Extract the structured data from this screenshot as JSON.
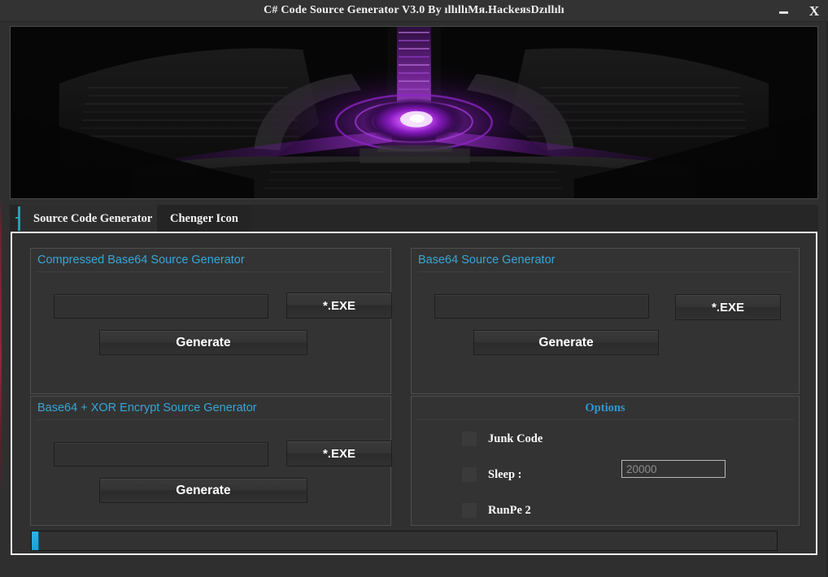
{
  "window": {
    "title": "C# Code Source Generator V3.0 By ıllıllıMя.HackeяsDzıllılı",
    "minimize_label": "—",
    "close_label": "X",
    "accent_color": "#2f9cb0",
    "group_title_color": "#37a6d6",
    "progress_color": "#2fb4e4"
  },
  "banner": {
    "alt": "dark sci-fi portal artwork with purple glowing core",
    "glow_color": "#b030e0"
  },
  "tabs": [
    {
      "label": "Source Code Generator",
      "active": true
    },
    {
      "label": "Chenger Icon",
      "active": false
    }
  ],
  "groups": {
    "compressed_base64": {
      "title": "Compressed Base64 Source  Generator",
      "path_value": "",
      "path_placeholder": "",
      "browse_label": "*.EXE",
      "generate_label": "Generate"
    },
    "base64": {
      "title": "Base64  Source  Generator",
      "path_value": "",
      "path_placeholder": "",
      "browse_label": "*.EXE",
      "generate_label": "Generate"
    },
    "base64_xor": {
      "title": "Base64 + XOR Encrypt Source  Generator",
      "path_value": "",
      "path_placeholder": "",
      "browse_label": "*.EXE",
      "generate_label": "Generate"
    },
    "options": {
      "title": "Options",
      "items": [
        {
          "label": "Junk  Code",
          "checked": false
        },
        {
          "label": "Sleep :",
          "checked": false
        },
        {
          "label": "RunPe 2",
          "checked": false
        }
      ],
      "sleep_value": "20000",
      "sleep_placeholder": "20000"
    }
  },
  "progress": {
    "value": 1,
    "label": ""
  }
}
